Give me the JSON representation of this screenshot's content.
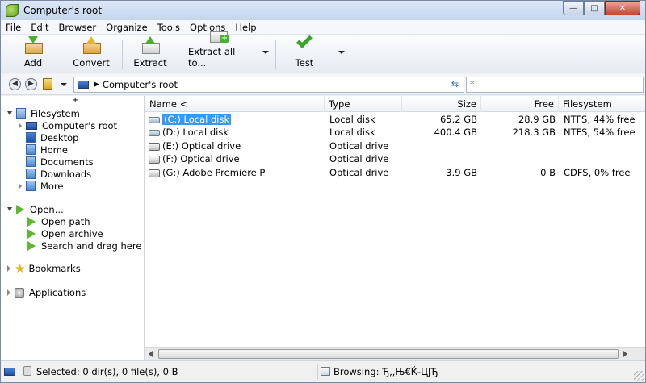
{
  "window": {
    "title": "Computer's root"
  },
  "menu": [
    "File",
    "Edit",
    "Browser",
    "Organize",
    "Tools",
    "Options",
    "Help"
  ],
  "toolbar": {
    "add_label": "Add",
    "convert_label": "Convert",
    "extract_label": "Extract",
    "extract_all_label": "Extract all to...",
    "test_label": "Test"
  },
  "address": {
    "path": "Computer's root",
    "search_placeholder": "*"
  },
  "tree": {
    "filesystem": "Filesystem",
    "computers_root": "Computer's root",
    "desktop": "Desktop",
    "home": "Home",
    "documents": "Documents",
    "downloads": "Downloads",
    "more": "More",
    "open": "Open...",
    "open_path": "Open path",
    "open_archive": "Open archive",
    "search_drag": "Search and drag here",
    "bookmarks": "Bookmarks",
    "applications": "Applications"
  },
  "columns": {
    "name": "Name <",
    "type": "Type",
    "size": "Size",
    "free": "Free",
    "filesystem": "Filesystem"
  },
  "rows": [
    {
      "name": "(C:) Local disk",
      "type": "Local disk",
      "size": "65.2 GB",
      "free": "28.9 GB",
      "fs": "NTFS, 44% free"
    },
    {
      "name": "(D:) Local disk",
      "type": "Local disk",
      "size": "400.4 GB",
      "free": "218.3 GB",
      "fs": "NTFS, 54% free"
    },
    {
      "name": "(E:) Optical drive",
      "type": "Optical drive",
      "size": "",
      "free": "",
      "fs": ""
    },
    {
      "name": "(F:) Optical drive",
      "type": "Optical drive",
      "size": "",
      "free": "",
      "fs": ""
    },
    {
      "name": "(G:) Adobe Premiere P",
      "type": "Optical drive",
      "size": "3.9 GB",
      "free": "0 B",
      "fs": "CDFS, 0% free"
    }
  ],
  "status": {
    "selected": "Selected: 0 dir(s), 0 file(s), 0 B",
    "browsing": "Browsing: Ђ,,Њ€Ќ-ЦЈЂ"
  }
}
